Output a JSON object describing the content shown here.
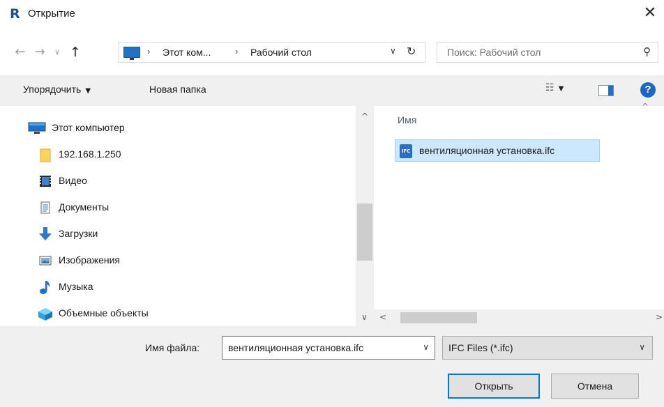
{
  "window": {
    "title": "Открытие",
    "close_glyph": "✕"
  },
  "nav": {
    "back_glyph": "←",
    "forward_glyph": "→",
    "recent_glyph": "∨",
    "up_glyph": "↑"
  },
  "address": {
    "separator": "›",
    "segments": [
      "Этот ком...",
      "Рабочий стол"
    ],
    "dropdown_glyph": "∨",
    "refresh_glyph": "↻"
  },
  "search": {
    "placeholder": "Поиск: Рабочий стол",
    "icon_glyph": "⚲"
  },
  "toolbar": {
    "organize_label": "Упорядочить",
    "new_folder_label": "Новая папка",
    "view_glyph": "☷",
    "caret": "▼",
    "help_glyph": "?"
  },
  "tree": {
    "items": [
      {
        "label": "Этот компьютер",
        "icon": "computer-icon"
      },
      {
        "label": "192.168.1.250",
        "icon": "network-folder-icon"
      },
      {
        "label": "Видео",
        "icon": "video-icon"
      },
      {
        "label": "Документы",
        "icon": "documents-icon"
      },
      {
        "label": "Загрузки",
        "icon": "downloads-icon"
      },
      {
        "label": "Изображения",
        "icon": "pictures-icon"
      },
      {
        "label": "Музыка",
        "icon": "music-icon"
      },
      {
        "label": "Объемные объекты",
        "icon": "3d-objects-icon"
      }
    ]
  },
  "scroll": {
    "up_glyph": "^",
    "down_glyph": "∨",
    "left_glyph": "<",
    "right_glyph": ">"
  },
  "filelist": {
    "column_header": "Имя",
    "sort_glyph": "^",
    "files": [
      {
        "name": "вентиляционная установка.ifc",
        "icon_text": "IFC",
        "selected": true
      }
    ]
  },
  "footer": {
    "filename_label": "Имя файла:",
    "filename_value": "вентиляционная установка.ifc",
    "filter_value": "IFC Files (*.ifc)",
    "dropdown_glyph": "∨",
    "open_label": "Открыть",
    "cancel_label": "Отмена"
  },
  "colors": {
    "accent": "#0078d7",
    "selection_bg": "#cce8ff",
    "selection_border": "#99d1ff",
    "chrome_bg": "#f0f0f0"
  }
}
